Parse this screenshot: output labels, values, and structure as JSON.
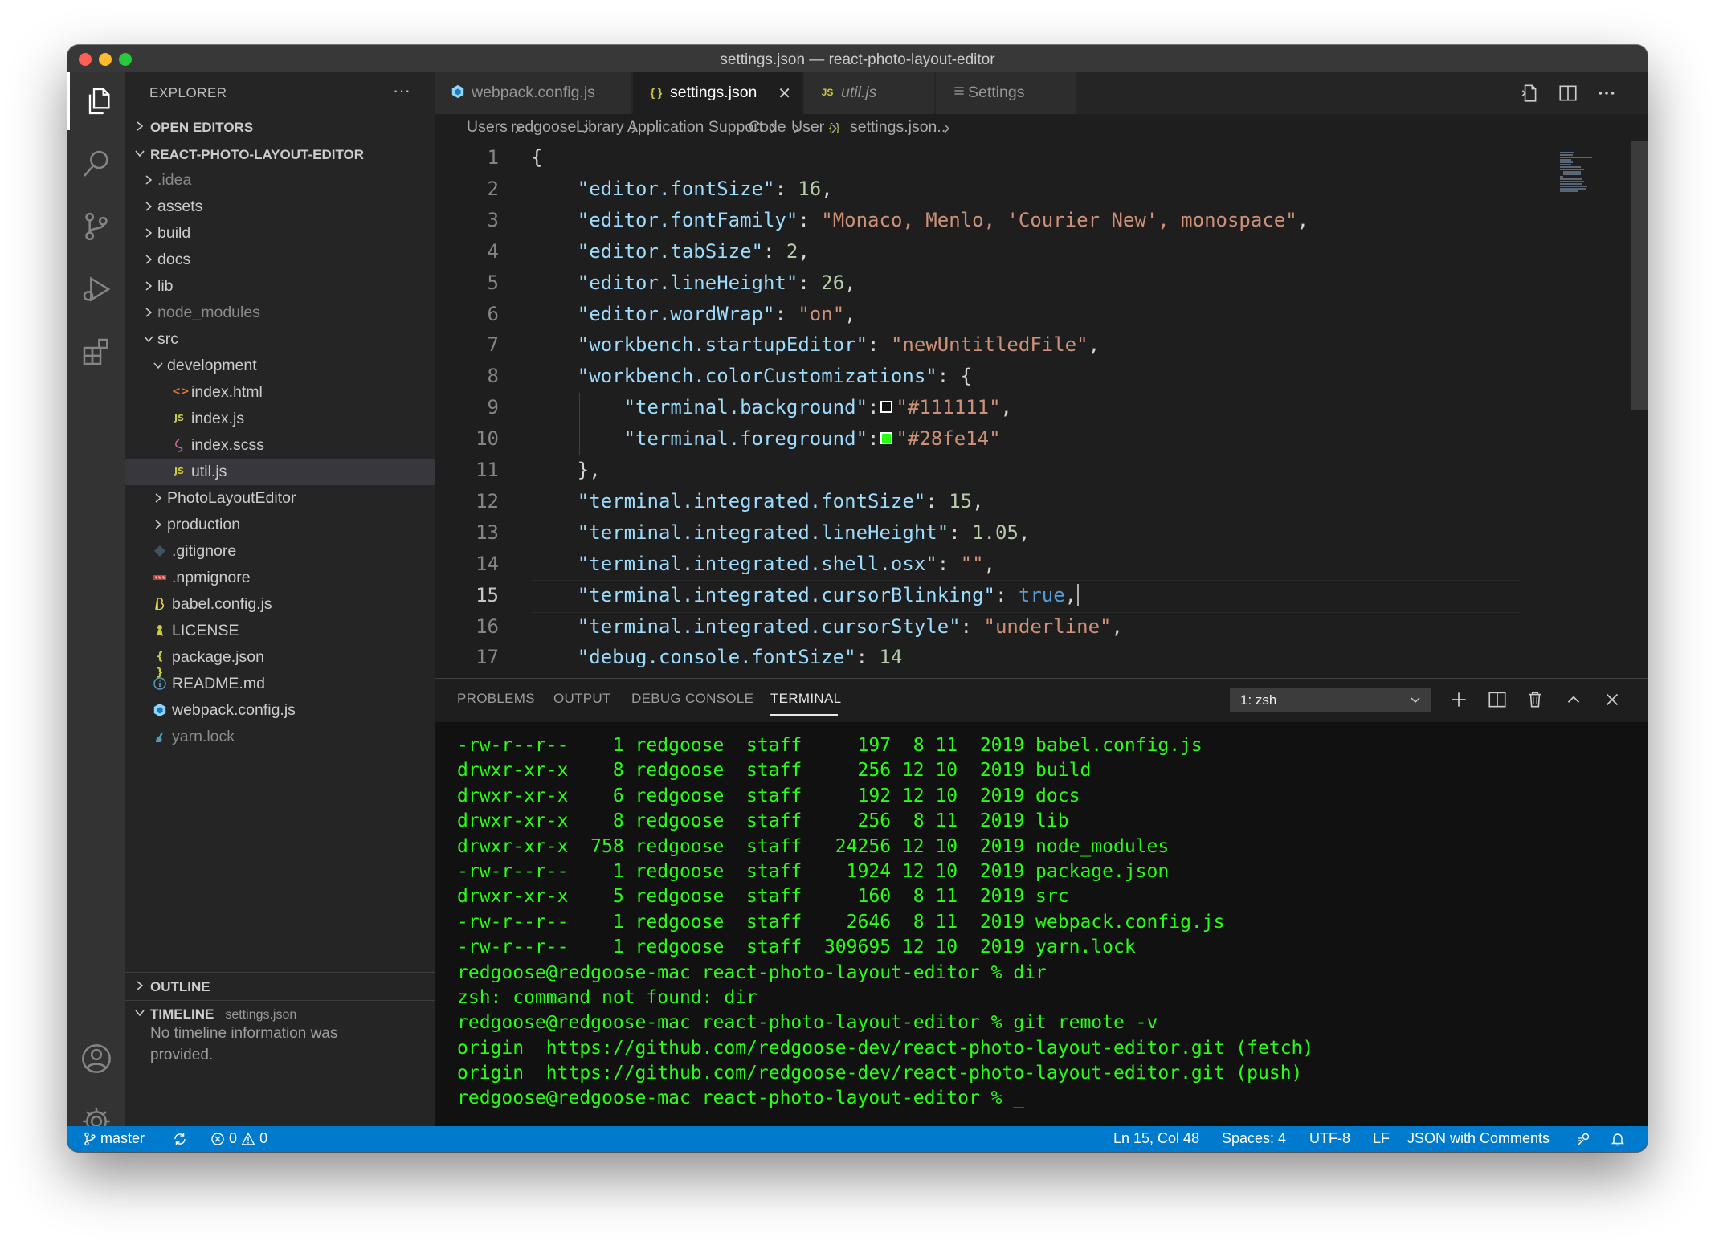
{
  "window": {
    "title": "settings.json — react-photo-layout-editor"
  },
  "sidebar": {
    "title": "EXPLORER",
    "more": "···",
    "open_editors": "OPEN EDITORS",
    "project": "REACT-PHOTO-LAYOUT-EDITOR",
    "tree": [
      {
        "name": ".idea",
        "type": "folder",
        "depth": 0,
        "dim": true
      },
      {
        "name": "assets",
        "type": "folder",
        "depth": 0
      },
      {
        "name": "build",
        "type": "folder",
        "depth": 0
      },
      {
        "name": "docs",
        "type": "folder",
        "depth": 0
      },
      {
        "name": "lib",
        "type": "folder",
        "depth": 0
      },
      {
        "name": "node_modules",
        "type": "folder",
        "depth": 0,
        "dim": true
      },
      {
        "name": "src",
        "type": "folder-open",
        "depth": 0
      },
      {
        "name": "development",
        "type": "folder-open",
        "depth": 1
      },
      {
        "name": "index.html",
        "type": "html",
        "depth": 2
      },
      {
        "name": "index.js",
        "type": "js",
        "depth": 2
      },
      {
        "name": "index.scss",
        "type": "scss",
        "depth": 2
      },
      {
        "name": "util.js",
        "type": "js",
        "depth": 2,
        "selected": true
      },
      {
        "name": "PhotoLayoutEditor",
        "type": "folder",
        "depth": 1
      },
      {
        "name": "production",
        "type": "folder",
        "depth": 1
      },
      {
        "name": ".gitignore",
        "type": "git",
        "depth": 0
      },
      {
        "name": ".npmignore",
        "type": "npm",
        "depth": 0
      },
      {
        "name": "babel.config.js",
        "type": "babel",
        "depth": 0
      },
      {
        "name": "LICENSE",
        "type": "license",
        "depth": 0
      },
      {
        "name": "package.json",
        "type": "json",
        "depth": 0
      },
      {
        "name": "README.md",
        "type": "info",
        "depth": 0
      },
      {
        "name": "webpack.config.js",
        "type": "webpack",
        "depth": 0
      },
      {
        "name": "yarn.lock",
        "type": "yarn",
        "depth": 0,
        "dim": true
      }
    ],
    "outline": "OUTLINE",
    "timeline": "TIMELINE",
    "timeline_file": "settings.json",
    "timeline_msg": "No timeline information was provided."
  },
  "tabs": [
    {
      "label": "webpack.config.js",
      "icon": "webpack",
      "italic": false
    },
    {
      "label": "settings.json",
      "icon": "json",
      "active": true,
      "close": "✕"
    },
    {
      "label": "util.js",
      "icon": "js",
      "italic": true
    },
    {
      "label": "Settings",
      "icon": "settings-list",
      "italic": false
    }
  ],
  "icon_text": {
    "js": "JS",
    "json": "{ }",
    "html": "<>",
    "braces": "{ }"
  },
  "breadcrumb": [
    "Users",
    "redgoose",
    "Library",
    "Application Support",
    "Code",
    "User",
    "settings.json",
    "..."
  ],
  "editor": {
    "line_numbers": [
      "1",
      "2",
      "3",
      "4",
      "5",
      "6",
      "7",
      "8",
      "9",
      "10",
      "11",
      "12",
      "13",
      "14",
      "15",
      "16",
      "17"
    ],
    "cursor_line": 15,
    "lines": [
      [
        {
          "t": "{",
          "c": ""
        }
      ],
      [
        {
          "t": "    ",
          "c": ""
        },
        {
          "t": "\"editor.fontSize\"",
          "c": "k"
        },
        {
          "t": ": ",
          "c": ""
        },
        {
          "t": "16",
          "c": "n"
        },
        {
          "t": ",",
          "c": ""
        }
      ],
      [
        {
          "t": "    ",
          "c": ""
        },
        {
          "t": "\"editor.fontFamily\"",
          "c": "k"
        },
        {
          "t": ": ",
          "c": ""
        },
        {
          "t": "\"Monaco, Menlo, 'Courier New', monospace\"",
          "c": "s"
        },
        {
          "t": ",",
          "c": ""
        }
      ],
      [
        {
          "t": "    ",
          "c": ""
        },
        {
          "t": "\"editor.tabSize\"",
          "c": "k"
        },
        {
          "t": ": ",
          "c": ""
        },
        {
          "t": "2",
          "c": "n"
        },
        {
          "t": ",",
          "c": ""
        }
      ],
      [
        {
          "t": "    ",
          "c": ""
        },
        {
          "t": "\"editor.lineHeight\"",
          "c": "k"
        },
        {
          "t": ": ",
          "c": ""
        },
        {
          "t": "26",
          "c": "n"
        },
        {
          "t": ",",
          "c": ""
        }
      ],
      [
        {
          "t": "    ",
          "c": ""
        },
        {
          "t": "\"editor.wordWrap\"",
          "c": "k"
        },
        {
          "t": ": ",
          "c": ""
        },
        {
          "t": "\"on\"",
          "c": "s"
        },
        {
          "t": ",",
          "c": ""
        }
      ],
      [
        {
          "t": "    ",
          "c": ""
        },
        {
          "t": "\"workbench.startupEditor\"",
          "c": "k"
        },
        {
          "t": ": ",
          "c": ""
        },
        {
          "t": "\"newUntitledFile\"",
          "c": "s"
        },
        {
          "t": ",",
          "c": ""
        }
      ],
      [
        {
          "t": "    ",
          "c": ""
        },
        {
          "t": "\"workbench.colorCustomizations\"",
          "c": "k"
        },
        {
          "t": ": {",
          "c": ""
        }
      ],
      [
        {
          "t": "        ",
          "c": ""
        },
        {
          "t": "\"terminal.background\"",
          "c": "k"
        },
        {
          "t": ":",
          "c": ""
        },
        {
          "t": "#111111",
          "c": "swatch"
        },
        {
          "t": "\"#111111\"",
          "c": "s"
        },
        {
          "t": ",",
          "c": ""
        }
      ],
      [
        {
          "t": "        ",
          "c": ""
        },
        {
          "t": "\"terminal.foreground\"",
          "c": "k"
        },
        {
          "t": ":",
          "c": ""
        },
        {
          "t": "#28fe14",
          "c": "swatch"
        },
        {
          "t": "\"#28fe14\"",
          "c": "s"
        }
      ],
      [
        {
          "t": "    },",
          "c": ""
        }
      ],
      [
        {
          "t": "    ",
          "c": ""
        },
        {
          "t": "\"terminal.integrated.fontSize\"",
          "c": "k"
        },
        {
          "t": ": ",
          "c": ""
        },
        {
          "t": "15",
          "c": "n"
        },
        {
          "t": ",",
          "c": ""
        }
      ],
      [
        {
          "t": "    ",
          "c": ""
        },
        {
          "t": "\"terminal.integrated.lineHeight\"",
          "c": "k"
        },
        {
          "t": ": ",
          "c": ""
        },
        {
          "t": "1.05",
          "c": "n"
        },
        {
          "t": ",",
          "c": ""
        }
      ],
      [
        {
          "t": "    ",
          "c": ""
        },
        {
          "t": "\"terminal.integrated.shell.osx\"",
          "c": "k"
        },
        {
          "t": ": ",
          "c": ""
        },
        {
          "t": "\"\"",
          "c": "s"
        },
        {
          "t": ",",
          "c": ""
        }
      ],
      [
        {
          "t": "    ",
          "c": ""
        },
        {
          "t": "\"terminal.integrated.cursorBlinking\"",
          "c": "k"
        },
        {
          "t": ": ",
          "c": ""
        },
        {
          "t": "true",
          "c": "b"
        },
        {
          "t": ",",
          "c": ""
        }
      ],
      [
        {
          "t": "    ",
          "c": ""
        },
        {
          "t": "\"terminal.integrated.cursorStyle\"",
          "c": "k"
        },
        {
          "t": ": ",
          "c": ""
        },
        {
          "t": "\"underline\"",
          "c": "s"
        },
        {
          "t": ",",
          "c": ""
        }
      ],
      [
        {
          "t": "    ",
          "c": ""
        },
        {
          "t": "\"debug.console.fontSize\"",
          "c": "k"
        },
        {
          "t": ": ",
          "c": ""
        },
        {
          "t": "14",
          "c": "n"
        }
      ]
    ]
  },
  "panel": {
    "tabs": [
      "PROBLEMS",
      "OUTPUT",
      "DEBUG CONSOLE",
      "TERMINAL"
    ],
    "active_tab": "TERMINAL",
    "terminal_select": "1: zsh",
    "terminal_lines": [
      "-rw-r--r--    1 redgoose  staff     197  8 11  2019 babel.config.js",
      "drwxr-xr-x    8 redgoose  staff     256 12 10  2019 build",
      "drwxr-xr-x    6 redgoose  staff     192 12 10  2019 docs",
      "drwxr-xr-x    8 redgoose  staff     256  8 11  2019 lib",
      "drwxr-xr-x  758 redgoose  staff   24256 12 10  2019 node_modules",
      "-rw-r--r--    1 redgoose  staff    1924 12 10  2019 package.json",
      "drwxr-xr-x    5 redgoose  staff     160  8 11  2019 src",
      "-rw-r--r--    1 redgoose  staff    2646  8 11  2019 webpack.config.js",
      "-rw-r--r--    1 redgoose  staff  309695 12 10  2019 yarn.lock",
      "redgoose@redgoose-mac react-photo-layout-editor % dir",
      "zsh: command not found: dir",
      "redgoose@redgoose-mac react-photo-layout-editor % git remote -v",
      "origin  https://github.com/redgoose-dev/react-photo-layout-editor.git (fetch)",
      "origin  https://github.com/redgoose-dev/react-photo-layout-editor.git (push)",
      "redgoose@redgoose-mac react-photo-layout-editor % _"
    ]
  },
  "statusbar": {
    "branch": "master",
    "errors": "0",
    "warnings": "0",
    "position": "Ln 15, Col 48",
    "spaces": "Spaces: 4",
    "encoding": "UTF-8",
    "eol": "LF",
    "language": "JSON with Comments"
  },
  "colors": {
    "statusbar": "#007acc",
    "terminal_fg": "#28fe14",
    "terminal_bg": "#111111"
  }
}
